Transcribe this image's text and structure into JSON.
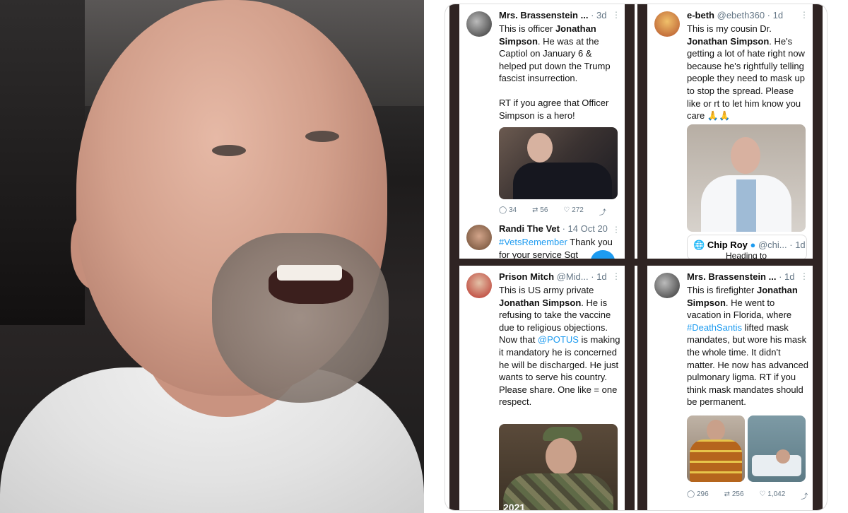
{
  "tweets": [
    {
      "name": "Mrs. Brassenstein ...",
      "meta": "· 3d",
      "body_pre": "This is officer ",
      "body_bold": "Jonathan Simpson",
      "body_post": ".  He was at the Captiol on January 6 & helped put down the Trump fascist insurrection.",
      "body_extra": "RT if you agree that Officer Simpson is a hero!",
      "stats": {
        "reply": "34",
        "retweet": "56",
        "like": "272"
      }
    },
    {
      "name": "e-beth",
      "handle": "@ebeth360",
      "meta": "· 1d",
      "body_pre": "This is my cousin Dr. ",
      "body_bold": "Jonathan Simpson",
      "body_post": ". He's getting a lot of hate right now because he's rightfully telling people they need to mask up to stop the spread. Please like or rt to let him know you care 🙏🙏",
      "quote_name": "Chip Roy",
      "quote_meta": "@chi... · 1d",
      "quote_text": "Heading to"
    },
    {
      "name": "Randi The Vet",
      "meta": "· 14 Oct 20",
      "body_link": "#VetsRemember",
      "body_post": " Thank you for your service Sgt"
    },
    {
      "name": "Prison Mitch",
      "handle": "@Mid...",
      "meta": "· 1d",
      "body_pre": "This is US army private ",
      "body_bold": "Jonathan Simpson",
      "body_post": ". He is refusing to take the vaccine due to religious objections. Now that ",
      "body_link": "@POTUS",
      "body_post2": " is making it mandatory he is concerned he will be discharged. He just wants to serve his country. Please share. One like = one respect.",
      "photo_label": "2021"
    },
    {
      "name": "Mrs. Brassenstein ...",
      "meta": "· 1d",
      "body_pre": "This is firefighter ",
      "body_bold": "Jonathan Simpson",
      "body_post": ".  He went to vacation in Florida, where ",
      "body_link": "#DeathSantis",
      "body_post2": " lifted mask mandates, but wore his mask the whole time.  It didn't matter.  He now has advanced pulmonary ligma.  RT if you think mask mandates should be permanent.",
      "stats": {
        "reply": "296",
        "retweet": "256",
        "like": "1,042"
      }
    }
  ],
  "colors": {
    "link": "#1d9bf0",
    "frame": "#2f2423"
  }
}
